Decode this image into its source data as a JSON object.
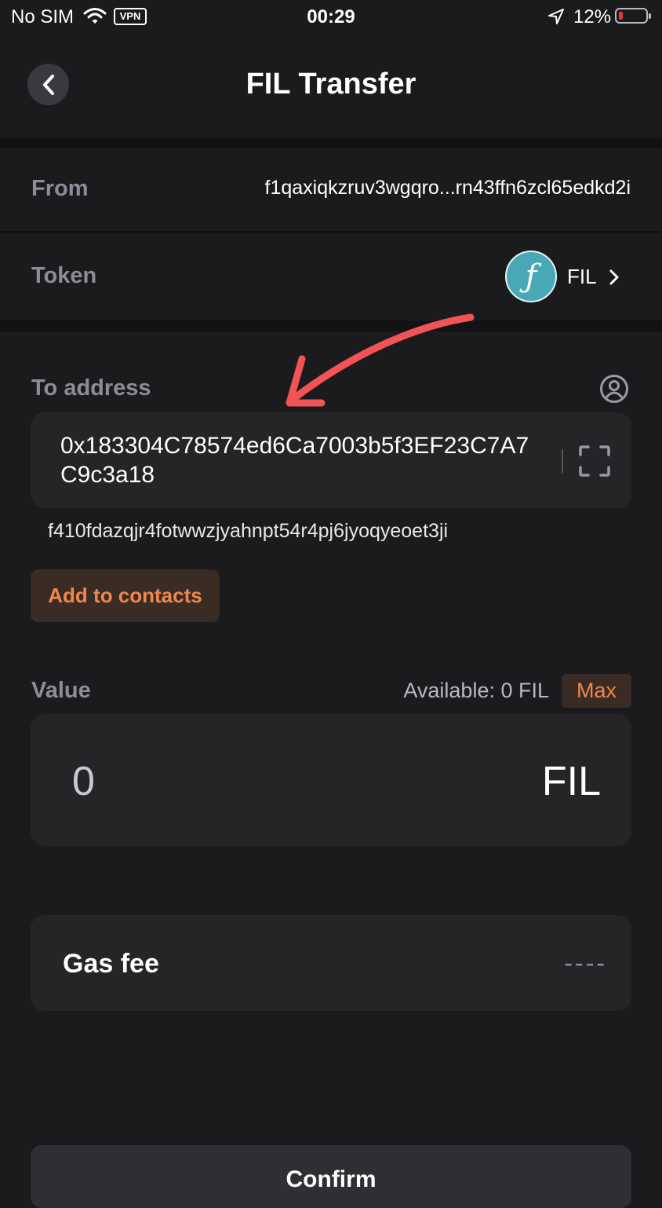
{
  "status_bar": {
    "carrier": "No SIM",
    "vpn": "VPN",
    "time": "00:29",
    "battery": "12%",
    "battery_color": "#e53935"
  },
  "header": {
    "title": "FIL Transfer",
    "back_icon": "chevron-left-icon"
  },
  "from": {
    "label": "From",
    "value": "f1qaxiqkzruv3wgqro...rn43ffn6zcl65edkd2i"
  },
  "token": {
    "label": "Token",
    "symbol": "FIL",
    "logo_glyph": "ƒ",
    "logo_color": "#48a8b5"
  },
  "to_address": {
    "label": "To address",
    "value": "0x183304C78574ed6Ca7003b5f3EF23C7A7C9c3a18",
    "converted": "f410fdazqjr4fotwwzjyahnpt54r4pj6jyoqyeoet3ji",
    "add_contact_label": "Add to contacts"
  },
  "value": {
    "label": "Value",
    "available": "Available: 0 FIL",
    "max_label": "Max",
    "amount": "0",
    "unit": "FIL"
  },
  "gas": {
    "label": "Gas fee",
    "value": "----"
  },
  "confirm": {
    "label": "Confirm"
  },
  "annotation": {
    "arrow_color": "#f05454"
  },
  "colors": {
    "background": "#1b1b1d",
    "card": "#252528",
    "accent": "#f0874a"
  }
}
